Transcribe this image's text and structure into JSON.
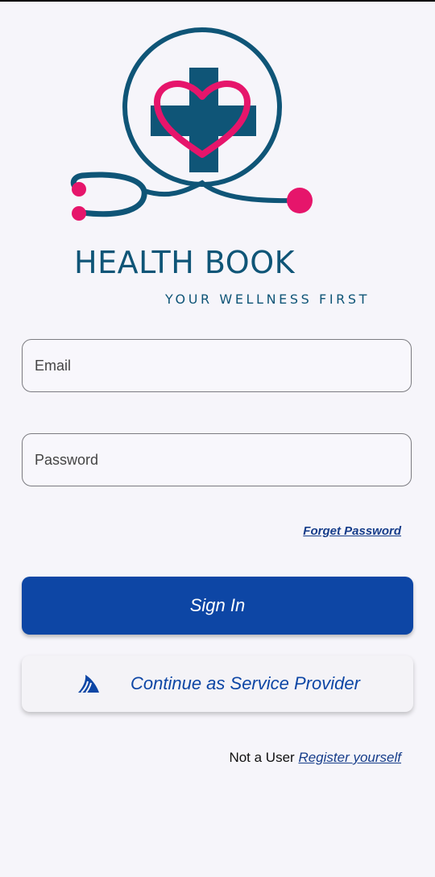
{
  "brand": {
    "title": "HEALTH BOOK",
    "tagline": "YOUR WELLNESS FIRST",
    "logo_icon": "stethoscope-heart-cross-icon",
    "colors": {
      "primary": "#0f5577",
      "accent": "#e6156b"
    }
  },
  "form": {
    "email_placeholder": "Email",
    "password_placeholder": "Password",
    "email_value": "",
    "password_value": ""
  },
  "links": {
    "forgot_password": "Forget Password"
  },
  "buttons": {
    "sign_in": "Sign In",
    "service_provider": "Continue as Service Provider",
    "service_provider_icon": "shark-fin-icon",
    "primary_color": "#0d46a5"
  },
  "register": {
    "prompt": "Not a User ",
    "link": "Register yourself"
  }
}
